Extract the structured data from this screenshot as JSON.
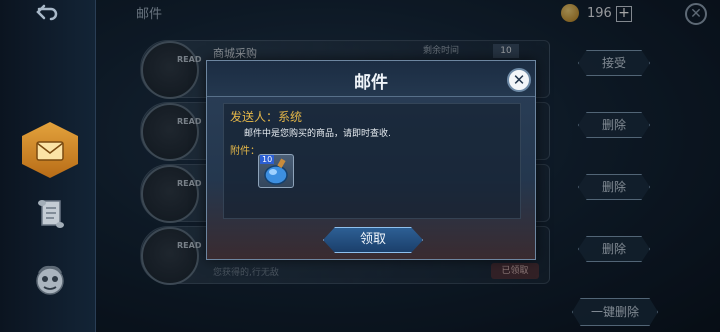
{
  "header": {
    "title": "邮件",
    "coin_count": "196",
    "plus_label": "+",
    "close_glyph": "✕"
  },
  "sidebar": {
    "tabs": [
      {
        "icon": "mail-letter-icon",
        "active": true
      },
      {
        "icon": "scroll-notice-icon",
        "active": false
      },
      {
        "icon": "friend-face-icon",
        "active": false
      }
    ]
  },
  "mail_list": {
    "rows": [
      {
        "title": "商城采购",
        "expire": "剩余时间",
        "qty": "10",
        "read_tag": "READ"
      },
      {
        "title": "",
        "read_tag": "READ"
      },
      {
        "title": "",
        "read_tag": "READ"
      },
      {
        "title": "",
        "read_tag": "READ",
        "note": "您获得的,行无敌",
        "claimed": "已领取"
      }
    ],
    "buttons": [
      "接受",
      "删除",
      "删除",
      "删除"
    ],
    "bulk_delete": "一键删除"
  },
  "modal": {
    "title": "邮件",
    "sender": "发送人：系统",
    "message": "邮件中是您购买的商品，请即时查收.",
    "attachment_label": "附件：",
    "item": {
      "level": "10",
      "icon": "potion-bottle-icon"
    },
    "claim_label": "领取",
    "close_glyph": "✕"
  },
  "colors": {
    "accent_gold": "#e3b648",
    "tab_active": "#e3a23c",
    "claim_blue": "#2d5f94"
  }
}
